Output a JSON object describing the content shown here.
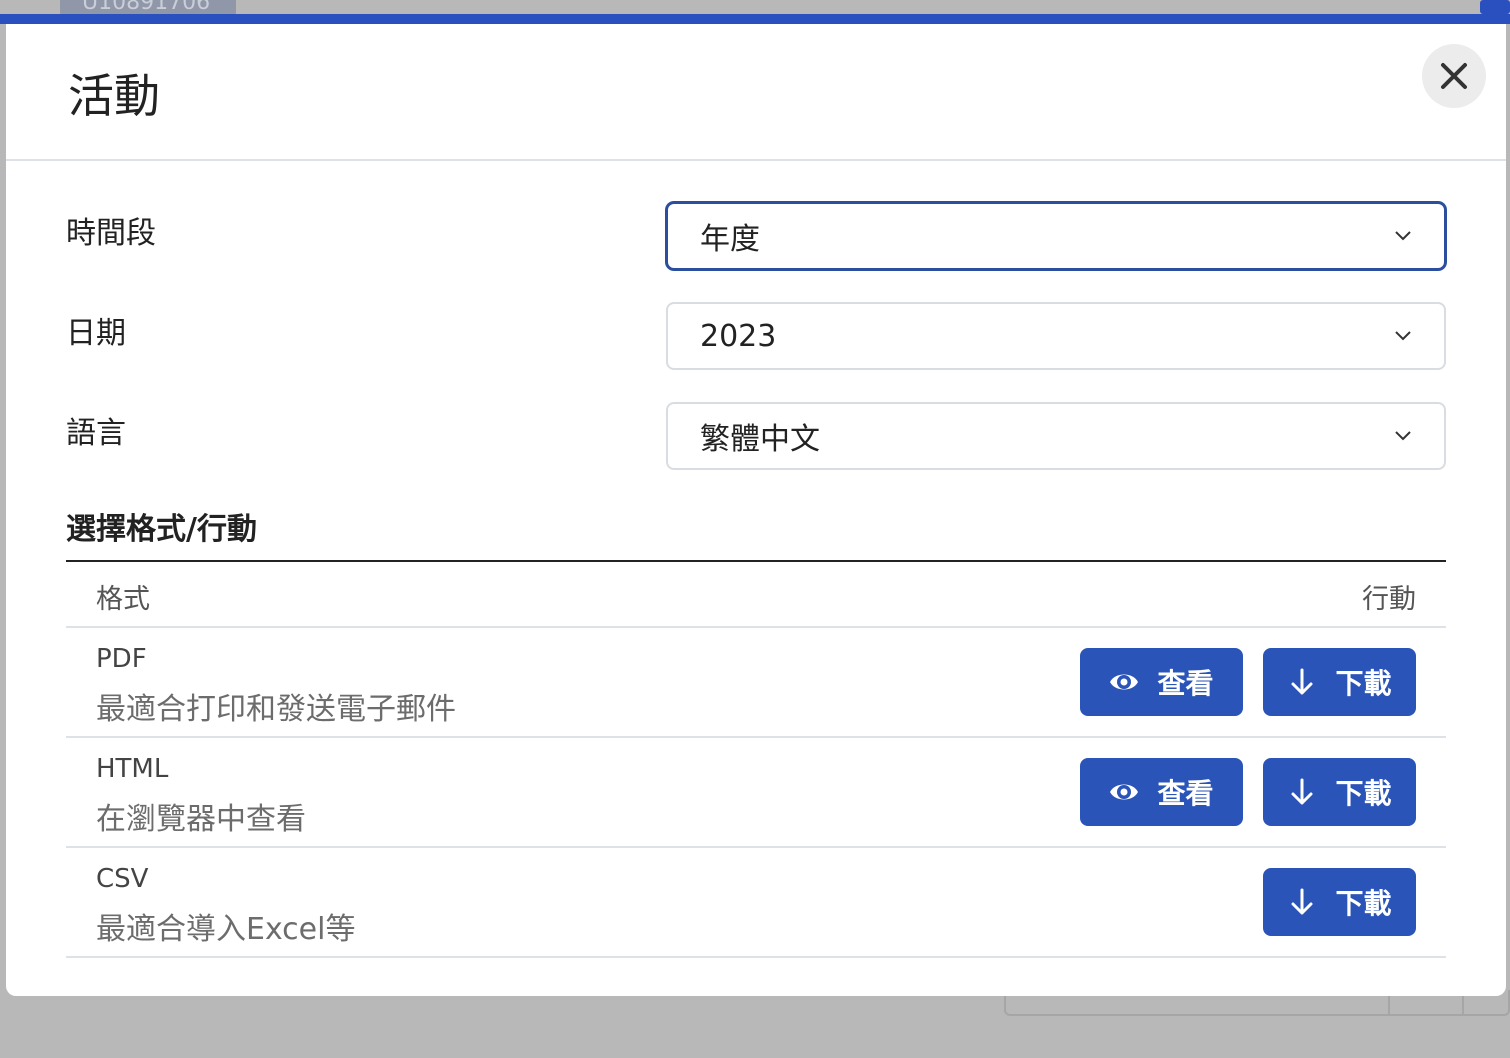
{
  "background": {
    "badge_text": "U10891706"
  },
  "modal": {
    "title": "活動",
    "close_label": "×"
  },
  "form": {
    "period_label": "時間段",
    "period_value": "年度",
    "date_label": "日期",
    "date_value": "2023",
    "language_label": "語言",
    "language_value": "繁體中文"
  },
  "formats": {
    "section_title": "選擇格式/行動",
    "col_format": "格式",
    "col_action": "行動",
    "rows": [
      {
        "name": "PDF",
        "desc": "最適合打印和發送電子郵件",
        "view_label": "查看",
        "download_label": "下載"
      },
      {
        "name": "HTML",
        "desc": "在瀏覽器中查看",
        "view_label": "查看",
        "download_label": "下載"
      },
      {
        "name": "CSV",
        "desc": "最適合導入Excel等",
        "download_label": "下載"
      }
    ]
  },
  "colors": {
    "primary": "#2a54b8",
    "focus_border": "#2c4e9e",
    "overlay": "#b8b8b8"
  },
  "icons": {
    "close": "close-icon",
    "chevron": "chevron-down-icon",
    "view": "eye-icon",
    "download": "arrow-down-icon"
  }
}
